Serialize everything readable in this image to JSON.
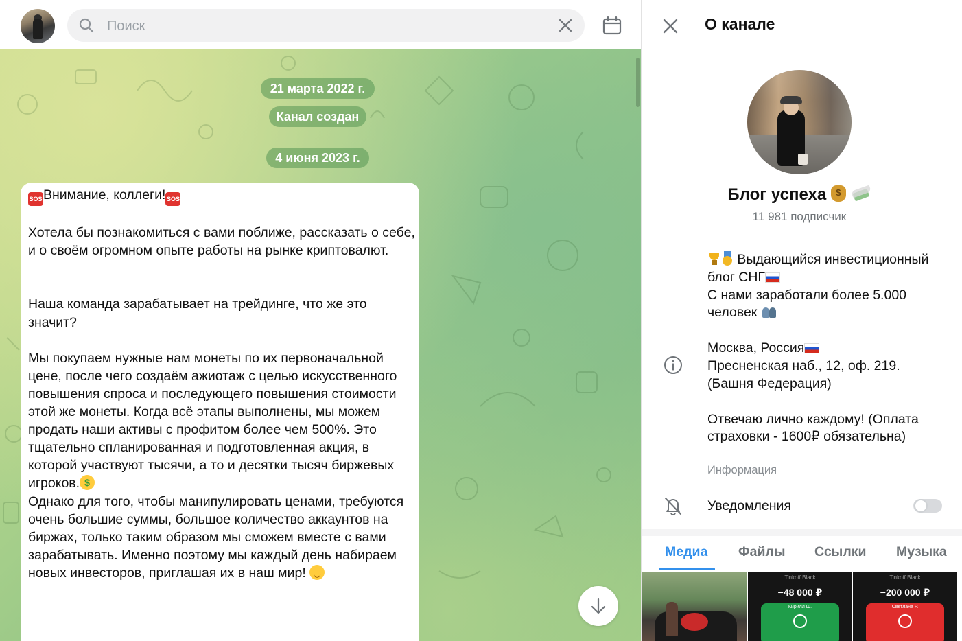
{
  "search": {
    "placeholder": "Поиск"
  },
  "chat": {
    "service_messages": [
      "21 марта 2022 г.",
      "Канал создан",
      "4 июня 2023 г."
    ],
    "message": {
      "title": "Внимание, коллеги!",
      "p1": "Хотела бы познакомиться с вами поближе, рассказать о себе, и о своём огромном опыте работы на рынке криптовалют.",
      "p2": "Наша команда зарабатывает на трейдинге, что же это значит?",
      "p3": "Мы покупаем нужные нам монеты по их первоначальной цене, после чего создаём ажиотаж с целью искусственного повышения спроса и последующего повышения стоимости этой же монеты. Когда всё этапы выполнены, мы можем продать наши активы с профитом более чем 500%. Это тщательно спланированная и подготовленная акция, в которой участвуют тысячи, а то и десятки тысяч биржевых игроков.",
      "p4": "Однако для того, чтобы манипулировать ценами, требуются очень большие суммы, большое количество аккаунтов на биржах, только таким образом мы сможем вместе с вами зарабатывать. Именно поэтому мы каждый день набираем новых инвесторов, приглашая их в наш мир!"
    }
  },
  "channel_info": {
    "header_title": "О канале",
    "name": "Блог успеха",
    "subscribers": "11 981 подписчик",
    "description": {
      "line1": "Выдающийся инвестиционный блог СНГ",
      "line2": "С нами заработали более 5.000 человек",
      "line3": "Москва, Россия",
      "line4": "Пресненская наб., 12, оф. 219. (Башня Федерация)",
      "line5": "Отвечаю лично каждому! (Оплата страховки - 1600₽ обязательна)"
    },
    "description_label": "Информация",
    "notifications_label": "Уведомления",
    "notifications_enabled": false,
    "tabs": [
      "Медиа",
      "Файлы",
      "Ссылки",
      "Музыка"
    ],
    "active_tab": "Медиа",
    "media_thumbs": [
      {
        "top": "",
        "amount": "",
        "card_label": ""
      },
      {
        "top": "Tinkoff Black",
        "amount": "−48 000 ₽",
        "card_label": "Кирилл Ш."
      },
      {
        "top": "Tinkoff Black",
        "amount": "−200 000 ₽",
        "card_label": "Светлана Р."
      }
    ]
  },
  "colors": {
    "accent": "#3390ec",
    "pill_bg": "#6aa866",
    "toggle_off": "#d8dadd"
  }
}
